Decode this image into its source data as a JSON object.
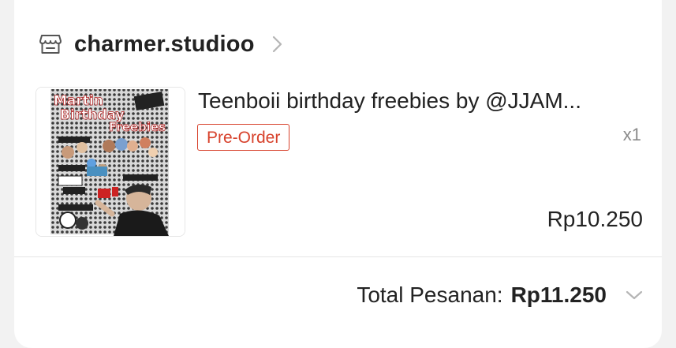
{
  "shop": {
    "name": "charmer.studioo",
    "icon": "shop-icon"
  },
  "product": {
    "title": "Teenboii birthday freebies by @JJAM...",
    "badge": "Pre-Order",
    "quantity": "x1",
    "price": "Rp10.250",
    "thumbnail": {
      "text_line1": "Martin",
      "text_line2": "Birthday",
      "text_line3": "Freebies"
    }
  },
  "order_total": {
    "label": "Total Pesanan:",
    "value": "Rp11.250"
  },
  "colors": {
    "accent": "#d7412b",
    "text_primary": "#222222",
    "text_secondary": "#8a8a8a",
    "divider": "#e5e5e5"
  }
}
